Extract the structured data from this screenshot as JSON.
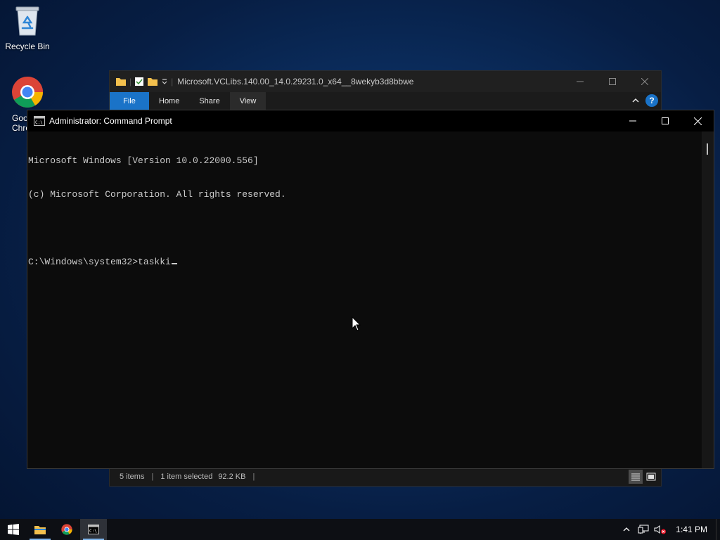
{
  "desktop": {
    "icons": [
      {
        "label": "Recycle Bin",
        "icon": "recycle-bin-icon"
      },
      {
        "label": "Google Chrome",
        "icon": "chrome-icon"
      }
    ]
  },
  "explorer": {
    "title": "Microsoft.VCLibs.140.00_14.0.29231.0_x64__8wekyb3d8bbwe",
    "tabs": [
      "File",
      "Home",
      "Share",
      "View"
    ],
    "help_label": "?",
    "status": {
      "items": "5 items",
      "selected": "1 item selected",
      "size": "92.2 KB"
    },
    "colors": {
      "accent": "#1a73c8"
    }
  },
  "cmd": {
    "title": "Administrator: Command Prompt",
    "lines": [
      "Microsoft Windows [Version 10.0.22000.556]",
      "(c) Microsoft Corporation. All rights reserved.",
      "",
      "C:\\Windows\\system32>taskki"
    ]
  },
  "taskbar": {
    "apps": [
      {
        "name": "File Explorer",
        "icon": "folder-icon",
        "running": true
      },
      {
        "name": "Google Chrome",
        "icon": "chrome-icon",
        "running": false
      },
      {
        "name": "Command Prompt",
        "icon": "cmd-icon",
        "running": true,
        "active": true
      }
    ],
    "tray": {
      "time": "1:41 PM",
      "icons": [
        "chevron-up-icon",
        "network-icon",
        "volume-muted-icon"
      ]
    }
  }
}
